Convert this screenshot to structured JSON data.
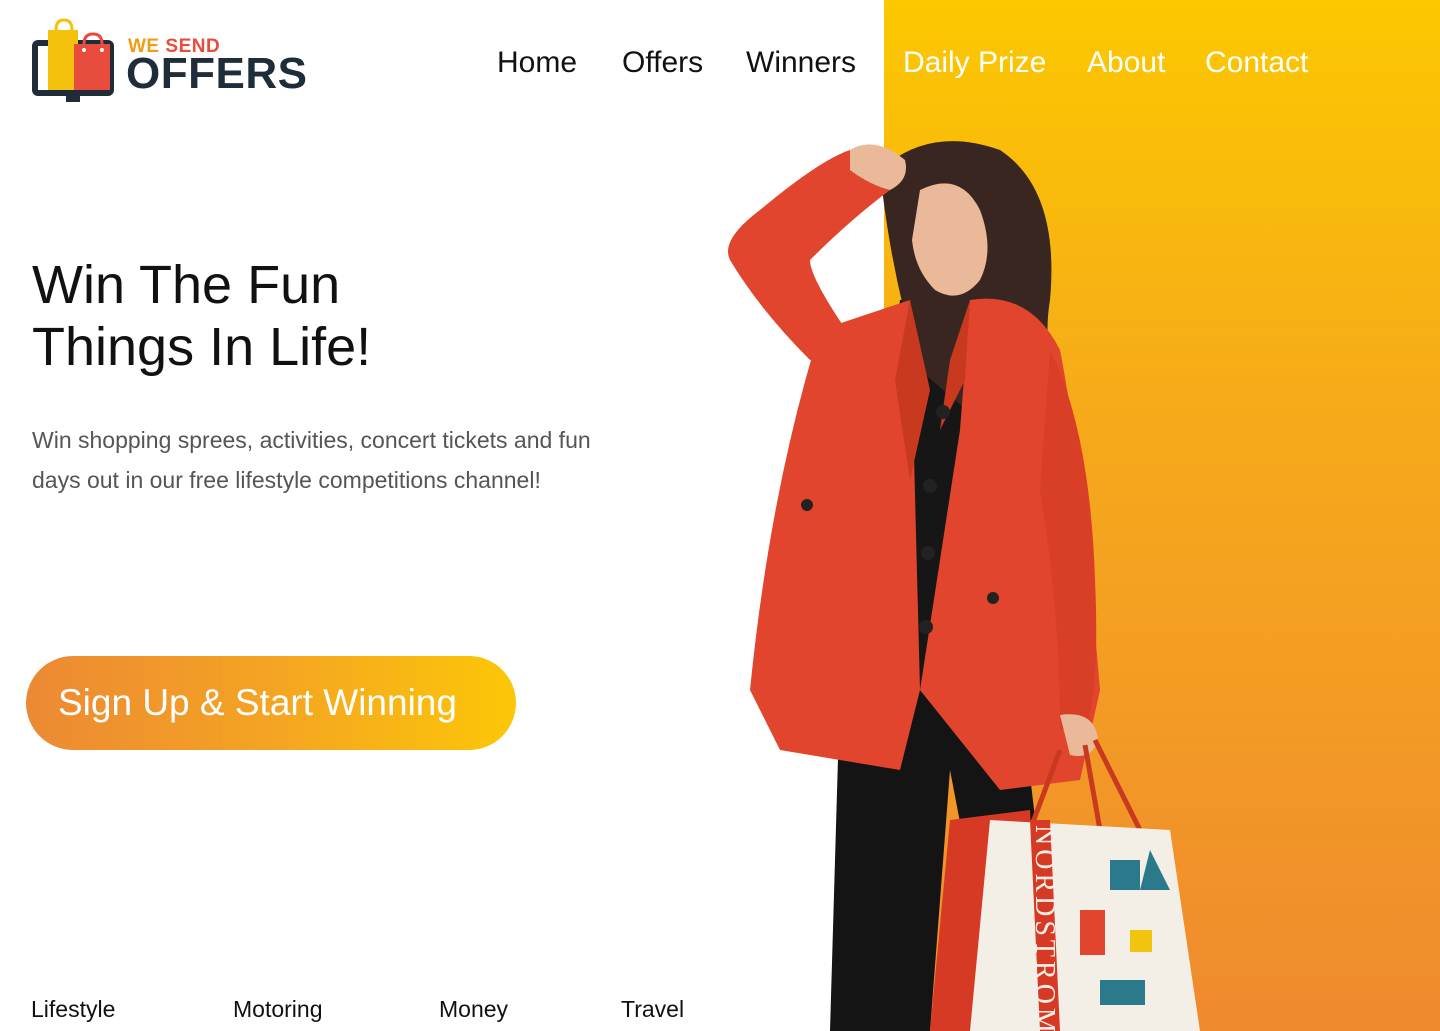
{
  "brand": {
    "small_word_1": "WE",
    "small_word_2": "SEND",
    "big_word": "OFFERS"
  },
  "nav": {
    "items": [
      "Home",
      "Offers",
      "Winners",
      "Daily Prize",
      "About",
      "Contact"
    ]
  },
  "hero": {
    "title_line_1": "Win The Fun",
    "title_line_2": "Things In Life!",
    "description": "Win shopping sprees, activities, concert tickets and fun days out in our free lifestyle competitions channel!",
    "cta_label": "Sign Up & Start Winning",
    "bag_text": "NORDSTROM"
  },
  "categories": [
    "Lifestyle",
    "Motoring",
    "Money",
    "Travel"
  ],
  "colors": {
    "accent_yellow": "#fcc800",
    "accent_orange": "#ef8a2f",
    "logo_red": "#e74c3c",
    "logo_navy": "#1f2d3a",
    "coat_red": "#e2452d"
  }
}
